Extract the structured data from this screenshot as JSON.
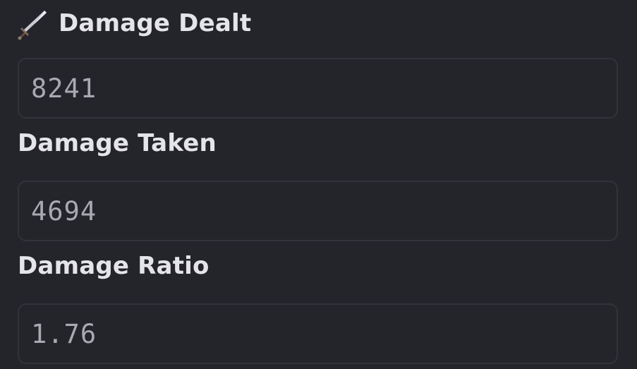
{
  "fields": [
    {
      "label": "Damage Dealt",
      "icon": "sword-icon",
      "value": "8241"
    },
    {
      "label": "Damage Taken",
      "value": "4694"
    },
    {
      "label": "Damage Ratio",
      "value": "1.76"
    }
  ],
  "colors": {
    "background": "#24242b",
    "label_text": "#e4e4ea",
    "value_text": "#a9a9b2",
    "field_border": "#32323a"
  }
}
